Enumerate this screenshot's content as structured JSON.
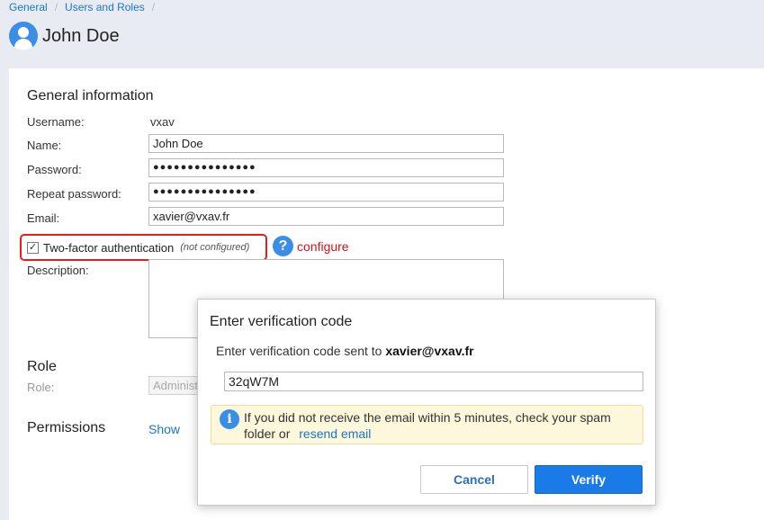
{
  "breadcrumb": {
    "items": [
      "General",
      "Users and Roles"
    ],
    "separator": "/"
  },
  "header": {
    "title": "John Doe",
    "avatar_icon": "user-avatar-icon"
  },
  "general": {
    "title": "General information",
    "username_label": "Username:",
    "username_value": "vxav",
    "name_label": "Name:",
    "name_value": "John Doe",
    "password_label": "Password:",
    "password_value": "●●●●●●●●●●●●●●●",
    "repeat_password_label": "Repeat password:",
    "repeat_password_value": "●●●●●●●●●●●●●●●",
    "email_label": "Email:",
    "email_value": "xavier@vxav.fr",
    "tfa_checkmark": "✓",
    "tfa_label": "Two-factor authentication",
    "tfa_status": "(not configured)",
    "help_icon_glyph": "?",
    "configure_label": "configure",
    "description_label": "Description:"
  },
  "role": {
    "title": "Role",
    "role_label": "Role:",
    "role_value": "Administ"
  },
  "permissions": {
    "title": "Permissions",
    "show_label": "Show"
  },
  "modal": {
    "title": "Enter verification code",
    "text_prefix": "Enter verification code sent to",
    "email": "xavier@vxav.fr",
    "code_value": "32qW7M",
    "info_icon_glyph": "i",
    "info_line1": "If you did not receive the email within 5 minutes, check your spam",
    "info_line2": "folder or",
    "resend_label": "resend email",
    "cancel_label": "Cancel",
    "verify_label": "Verify"
  },
  "colors": {
    "accent": "#1a7ae8",
    "highlight_border": "#e02020",
    "configure_link": "#d8101a",
    "info_background": "#fdf7dc"
  }
}
